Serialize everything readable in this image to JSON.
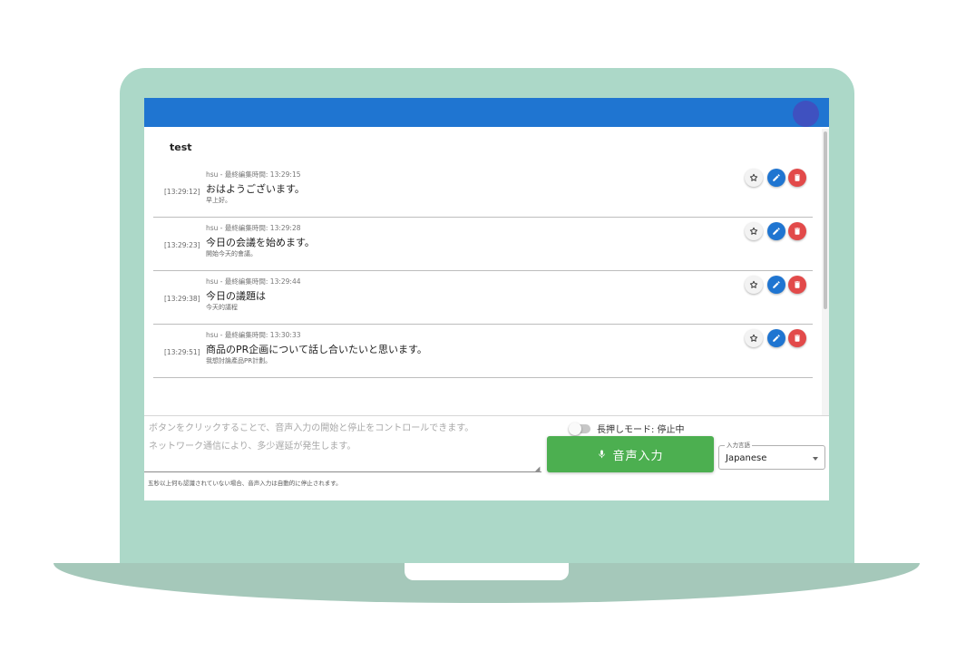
{
  "app": {
    "room_title": "test"
  },
  "messages": [
    {
      "time": "[13:29:12]",
      "meta": "hsu - 最終編集時間: 13:29:15",
      "text": "おはようございます。",
      "translation": "早上好。"
    },
    {
      "time": "[13:29:23]",
      "meta": "hsu - 最終編集時間: 13:29:28",
      "text": "今日の会議を始めます。",
      "translation": "開始今天的會議。"
    },
    {
      "time": "[13:29:38]",
      "meta": "hsu - 最終編集時間: 13:29:44",
      "text": "今日の議題は",
      "translation": "今天的議程"
    },
    {
      "time": "[13:29:51]",
      "meta": "hsu - 最終編集時間: 13:30:33",
      "text": "商品のPR企画について話し合いたいと思います。",
      "translation": "我想討論產品PR計劃。"
    }
  ],
  "message_actions": {
    "star_icon": "star-outline-icon",
    "edit_icon": "pencil-icon",
    "delete_icon": "trash-icon"
  },
  "input": {
    "placeholder": "ボタンをクリックすることで、音声入力の開始と停止をコントロールできます。\nネットワーク通信により、多少遅延が発生します。",
    "hint": "五秒以上何も認識されていない場合、音声入力は自動的に停止されます。"
  },
  "long_press": {
    "label": "長押しモード: 停止中",
    "enabled": false
  },
  "voice_button": {
    "label": "音声入力",
    "icon": "microphone-icon"
  },
  "language": {
    "legend": "入力言語",
    "value": "Japanese"
  },
  "colors": {
    "app_bar": "#1f75d1",
    "voice_button": "#4caf50",
    "edit_button": "#1f75d1",
    "delete_button": "#e24a4a",
    "laptop": "#acd8c8"
  }
}
